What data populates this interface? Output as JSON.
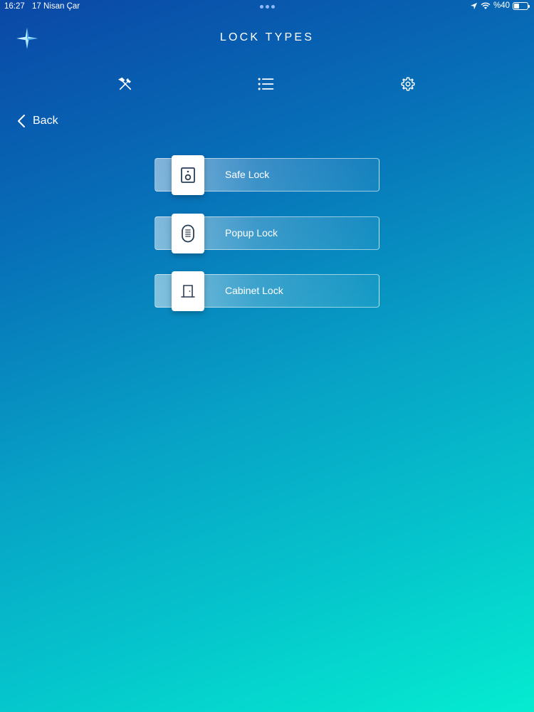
{
  "status_bar": {
    "time": "16:27",
    "date": "17 Nisan Çar",
    "battery_text": "%40",
    "battery_level": 0.4
  },
  "header": {
    "title": "LOCK TYPES",
    "logo_icon": "star-logo-icon"
  },
  "toolbar": {
    "items": [
      {
        "icon": "tools-icon"
      },
      {
        "icon": "list-icon"
      },
      {
        "icon": "gear-icon"
      }
    ]
  },
  "navigation": {
    "back_label": "Back"
  },
  "lock_types": [
    {
      "label": "Safe Lock",
      "icon": "safe-icon"
    },
    {
      "label": "Popup Lock",
      "icon": "keypad-icon"
    },
    {
      "label": "Cabinet Lock",
      "icon": "cabinet-door-icon"
    }
  ],
  "colors": {
    "gradient_start": "#0a47a6",
    "gradient_end": "#05ecd0",
    "icon_color": "#2b3f55"
  }
}
